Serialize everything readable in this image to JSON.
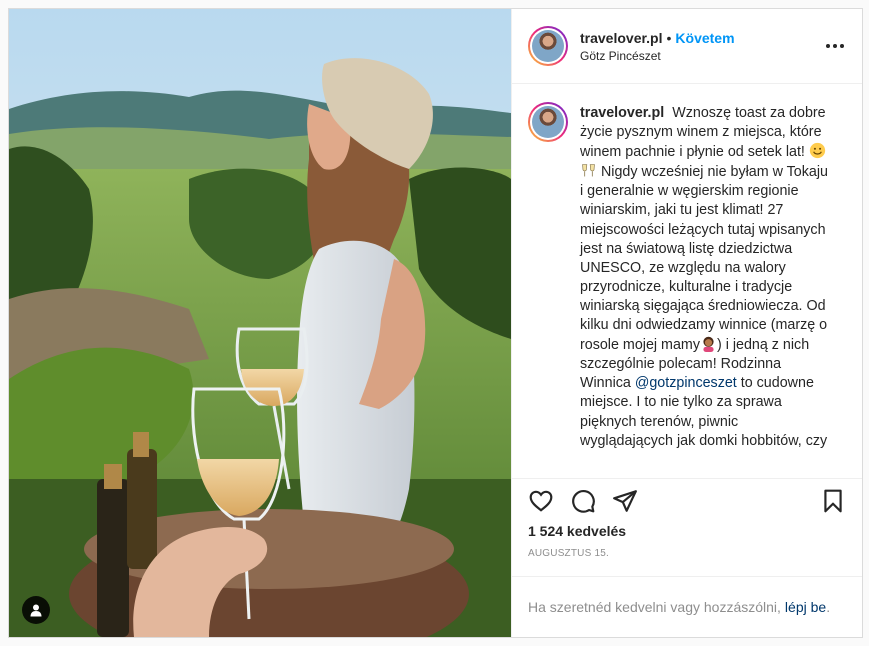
{
  "post": {
    "username": "travelover.pl",
    "follow_label": "Követem",
    "dot": "•",
    "location": "Götz Pincészet",
    "caption_part1": "Wznoszę toast za dobre życie pysznym winem z miejsca, które winem pachnie i płynie od setek lat!",
    "caption_part2": "Nigdy wcześniej nie byłam w Tokaju i generalnie w węgierskim regionie winiarskim, jaki tu jest klimat! 27 miejscowości leżących tutaj wpisanych jest na światową listę dziedzictwa UNESCO, ze względu na walory przyrodnicze, kulturalne i tradycje winiarską sięgająca średniowiecza. Od kilku dni odwiedzamy winnice (marzę o rosole mojej mamy",
    "caption_part3": ") i jedną z nich szczególnie polecam! Rodzinna Winnica",
    "mention": "@gotzpinceszet",
    "caption_part4": "to cudowne miejsce. I to nie tylko za sprawa pięknych terenów, piwnic wyglądających jak domki hobbitów, czy",
    "likes": "1 524 kedvelés",
    "date": "AUGUSZTUS 15.",
    "login_prompt": "Ha szeretnéd kedvelni vagy hozzászólni,",
    "login_link": "lépj be",
    "login_end": "."
  },
  "icons": {
    "like": "heart-icon",
    "comment": "comment-icon",
    "share": "paper-plane-icon",
    "save": "bookmark-icon",
    "more": "more-options-icon",
    "user_tag": "user-tag-icon"
  },
  "colors": {
    "accent": "#0095f6",
    "mention": "#00376b",
    "muted": "#8e8e8e",
    "border": "#dbdbdb"
  }
}
